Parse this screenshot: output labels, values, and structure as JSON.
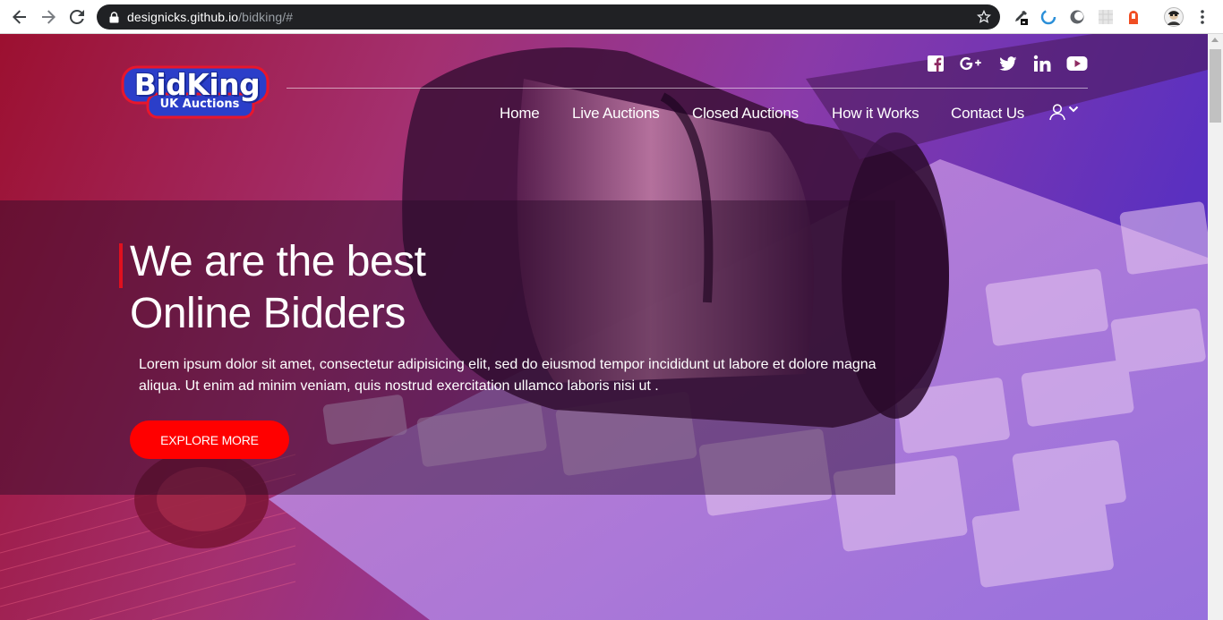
{
  "browser": {
    "url_host": "designicks.github.io",
    "url_path": "/bidking/#"
  },
  "logo": {
    "main": "BidKing",
    "sub": "UK Auctions"
  },
  "social_icons": [
    "facebook-icon",
    "google-plus-icon",
    "twitter-icon",
    "linkedin-icon",
    "youtube-icon"
  ],
  "nav": {
    "items": [
      "Home",
      "Live Auctions",
      "Closed Auctions",
      "How it Works",
      "Contact Us"
    ]
  },
  "hero": {
    "title_line1": "We are the best",
    "title_line2": "Online Bidders",
    "text": "Lorem ipsum dolor sit amet, consectetur adipisicing elit, sed do eiusmod tempor incididunt ut labore et dolore magna aliqua. Ut enim ad minim veniam, quis nostrud exercitation ullamco laboris nisi ut .",
    "button": "EXPLORE MORE"
  },
  "colors": {
    "accent": "#ff0000",
    "chrome_bar": "#202124",
    "gradient_left": "#aa1236",
    "gradient_right": "#6932c8"
  }
}
